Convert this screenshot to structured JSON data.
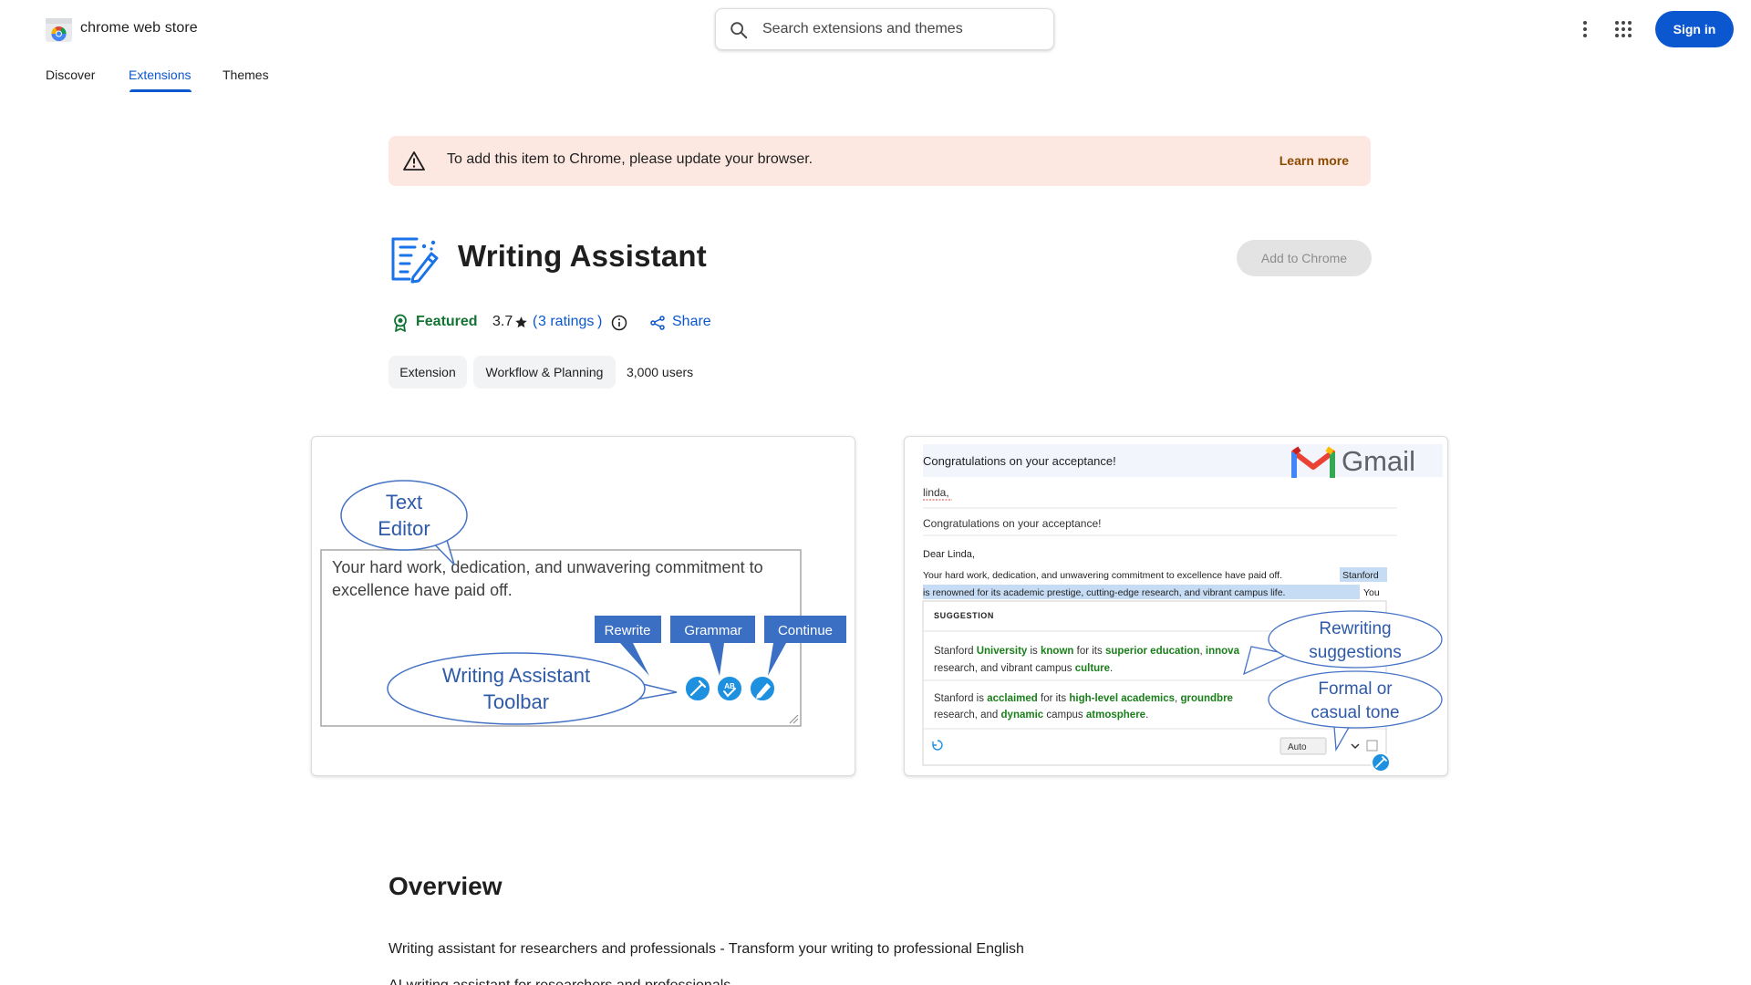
{
  "header": {
    "logo_text": "chrome web store",
    "search_placeholder": "Search extensions and themes",
    "sign_in": "Sign in"
  },
  "tabs": [
    {
      "label": "Discover",
      "active": false
    },
    {
      "label": "Extensions",
      "active": true
    },
    {
      "label": "Themes",
      "active": false
    }
  ],
  "banner": {
    "text": "To add this item to Chrome, please update your browser.",
    "link": "Learn more"
  },
  "extension": {
    "title": "Writing Assistant",
    "add_button": "Add to Chrome",
    "featured": "Featured",
    "rating": "3.7",
    "ratings_link": "3 ratings",
    "share": "Share",
    "chips": [
      "Extension",
      "Workflow & Planning"
    ],
    "users": "3,000 users"
  },
  "screenshot1": {
    "callout_editor_line1": "Text",
    "callout_editor_line2": "Editor",
    "editor_text_line1": "Your hard work, dedication, and unwavering commitment to",
    "editor_text_line2": "excellence have paid off.",
    "btn_rewrite": "Rewrite",
    "btn_grammar": "Grammar",
    "btn_continue": "Continue",
    "callout_toolbar_line1": "Writing Assistant",
    "callout_toolbar_line2": "Toolbar"
  },
  "screenshot2": {
    "subject": "Congratulations on your acceptance!",
    "gmail_label": "Gmail",
    "to": "linda,",
    "subject_line": "Congratulations on your acceptance!",
    "greeting": "Dear Linda,",
    "body_line1_plain": "Your hard work, dedication, and unwavering commitment to excellence have paid off.",
    "body_line1_highlight": "Stanford",
    "body_line2_highlight": "is renowned for its academic prestige, cutting-edge research, and vibrant campus life.",
    "body_line2_plain": "You",
    "suggestion_header": "SUGGESTION",
    "s1_l1_a": "Stanford",
    "s1_l1_b": "University",
    "s1_l1_c": "is",
    "s1_l1_d": "known",
    "s1_l1_e": "for its",
    "s1_l1_f": "superior education",
    "s1_l1_g": ",",
    "s1_l1_h": "innova",
    "s1_l2_a": "research, and vibrant campus",
    "s1_l2_b": "culture",
    "s1_l2_c": ".",
    "s2_l1_a": "Stanford is",
    "s2_l1_b": "acclaimed",
    "s2_l1_c": "for its",
    "s2_l1_d": "high-level academics",
    "s2_l1_e": ",",
    "s2_l1_f": "groundbre",
    "s2_l2_a": "research, and",
    "s2_l2_b": "dynamic",
    "s2_l2_c": "campus",
    "s2_l2_d": "atmosphere",
    "s2_l2_e": ".",
    "select_value": "Auto",
    "callout_rewriting_line1": "Rewriting",
    "callout_rewriting_line2": "suggestions",
    "callout_tone_line1": "Formal or",
    "callout_tone_line2": "casual tone"
  },
  "overview": {
    "title": "Overview",
    "line1": "Writing assistant for researchers and professionals - Transform your writing to professional English",
    "line2": "AI writing assistant for researchers and professionals"
  },
  "colors": {
    "accent": "#0b57d0",
    "banner_bg": "#fce8e1",
    "featured": "#137333",
    "callout_blue": "#4472c4",
    "toolbar_btn": "#3a6fc4",
    "suggest_green": "#1a7f1a"
  }
}
